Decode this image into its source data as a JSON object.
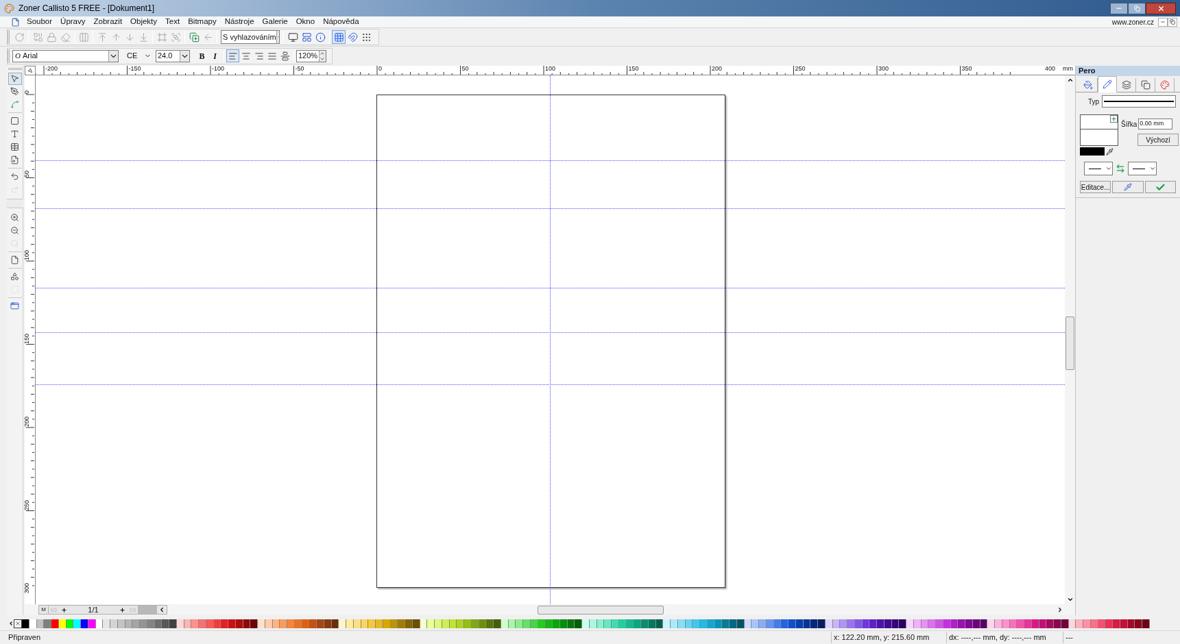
{
  "window": {
    "title": "Zoner Callisto 5 FREE - [Dokument1]"
  },
  "menu": {
    "items": [
      "Soubor",
      "Úpravy",
      "Zobrazit",
      "Objekty",
      "Text",
      "Bitmapy",
      "Nástroje",
      "Galerie",
      "Okno",
      "Nápověda"
    ],
    "link": "www.zoner.cz"
  },
  "toolbar": [
    {
      "kind": "refresh",
      "disabled": true
    },
    {
      "kind": "separator"
    },
    {
      "kind": "combine",
      "disabled": true
    },
    {
      "kind": "lock",
      "disabled": true
    },
    {
      "kind": "eraser",
      "disabled": true
    },
    {
      "kind": "separator"
    },
    {
      "kind": "columns",
      "disabled": true
    },
    {
      "kind": "separator"
    },
    {
      "kind": "to-top",
      "disabled": true
    },
    {
      "kind": "up",
      "disabled": true
    },
    {
      "kind": "down",
      "disabled": true
    },
    {
      "kind": "to-bottom",
      "disabled": true
    },
    {
      "kind": "separator"
    },
    {
      "kind": "frame",
      "disabled": true
    },
    {
      "kind": "group",
      "disabled": true
    },
    {
      "kind": "separator"
    },
    {
      "kind": "add-object",
      "disabled": false
    },
    {
      "kind": "back",
      "disabled": true
    },
    {
      "kind": "separator"
    },
    {
      "kind": "dropdown",
      "value": "S vyhlazováním"
    },
    {
      "kind": "separator"
    },
    {
      "kind": "monitor",
      "disabled": false
    },
    {
      "kind": "layout",
      "disabled": false
    },
    {
      "kind": "info",
      "disabled": false
    },
    {
      "kind": "separator"
    },
    {
      "kind": "grid",
      "disabled": false,
      "pressed": true
    },
    {
      "kind": "snap",
      "disabled": false,
      "pressed": false
    },
    {
      "kind": "dots",
      "disabled": false,
      "pressed": false
    }
  ],
  "format_bar": {
    "font_glyph": "O",
    "font": "Arial",
    "charset": "CE",
    "size": "24.0",
    "style_buttons": [
      {
        "label": "B",
        "pressed": false
      },
      {
        "label": "I",
        "pressed": false
      }
    ],
    "align_buttons": [
      {
        "kind": "left",
        "selected": true
      },
      {
        "kind": "center",
        "selected": false
      },
      {
        "kind": "right",
        "selected": false
      },
      {
        "kind": "justify",
        "selected": false
      },
      {
        "kind": "full",
        "selected": false
      }
    ],
    "zoom": "120%"
  },
  "toolbox": [
    {
      "kind": "pointer",
      "disabled": false,
      "selected": true
    },
    {
      "kind": "shape",
      "disabled": false,
      "selected": false
    },
    {
      "kind": "nodes",
      "disabled": false,
      "selected": false
    },
    {
      "kind": "separator"
    },
    {
      "kind": "rectangle",
      "disabled": false,
      "selected": false
    },
    {
      "kind": "text",
      "disabled": false,
      "selected": false
    },
    {
      "kind": "table",
      "disabled": false,
      "selected": false
    },
    {
      "kind": "import",
      "disabled": false,
      "selected": false
    },
    {
      "kind": "separator"
    },
    {
      "kind": "undo",
      "disabled": false,
      "selected": false
    },
    {
      "kind": "redo",
      "disabled": true,
      "selected": false
    },
    {
      "kind": "break"
    },
    {
      "kind": "zoom-in",
      "disabled": false,
      "selected": false
    },
    {
      "kind": "zoom-out",
      "disabled": false,
      "selected": false
    },
    {
      "kind": "zoom-back",
      "disabled": true,
      "selected": false
    },
    {
      "kind": "separator"
    },
    {
      "kind": "page",
      "disabled": false,
      "selected": false
    },
    {
      "kind": "separator"
    },
    {
      "kind": "shape-tool",
      "disabled": false,
      "selected": false
    },
    {
      "kind": "bounds",
      "disabled": true,
      "selected": false
    },
    {
      "kind": "separator"
    },
    {
      "kind": "window",
      "disabled": false,
      "selected": false
    }
  ],
  "horizontal_ruler": {
    "labels": [
      "-200",
      "-150",
      "-100",
      "-50",
      "0",
      "50",
      "100",
      "150",
      "200",
      "250",
      "300",
      "350",
      "400"
    ],
    "unit": "mm"
  },
  "vertical_ruler": {
    "labels": [
      "0",
      "50",
      "100",
      "150",
      "200",
      "250",
      "300"
    ]
  },
  "page_nav": {
    "first_label": "M",
    "page": "1/1"
  },
  "panel": {
    "title": "Pero",
    "tabs": [
      {
        "kind": "fill",
        "selected": false
      },
      {
        "kind": "pen",
        "selected": true
      },
      {
        "kind": "transparency",
        "selected": false
      },
      {
        "kind": "shadow",
        "selected": false
      },
      {
        "kind": "palette",
        "selected": false
      }
    ],
    "type_label": "Typ",
    "width_label": "Šířka",
    "width_value": "0.00 mm",
    "default_button": "Výchozí",
    "edit_button": "Editace..."
  },
  "palette": [
    {
      "color": "#000000"
    },
    {
      "color": "#ffffff"
    },
    {
      "color": "#c0c0c0"
    },
    {
      "color": "#808080"
    },
    {
      "color": "#ff0000"
    },
    {
      "color": "#ffff00"
    },
    {
      "color": "#00ff00"
    },
    {
      "color": "#00ffff"
    },
    {
      "color": "#0000ff"
    },
    {
      "color": "#ff00ff"
    },
    {
      "color": "#ffffff"
    },
    {
      "color": "#e6e6e6"
    },
    {
      "color": "#d4d4d4"
    },
    {
      "color": "#c4c4c4"
    },
    {
      "color": "#b4b4b4"
    },
    {
      "color": "#a4a4a4"
    },
    {
      "color": "#949494"
    },
    {
      "color": "#848484"
    },
    {
      "color": "#6e6e6e"
    },
    {
      "color": "#585858"
    },
    {
      "color": "#404040"
    },
    {
      "color": "#ffd6d6"
    },
    {
      "color": "#ffb3b3"
    },
    {
      "color": "#ff9090"
    },
    {
      "color": "#f87171"
    },
    {
      "color": "#ff5555"
    },
    {
      "color": "#f03c3c"
    },
    {
      "color": "#e52020"
    },
    {
      "color": "#d01010"
    },
    {
      "color": "#b00c0c"
    },
    {
      "color": "#900808"
    },
    {
      "color": "#700404"
    },
    {
      "color": "#ffe0cc"
    },
    {
      "color": "#ffcba8"
    },
    {
      "color": "#ffb380"
    },
    {
      "color": "#f99b5a"
    },
    {
      "color": "#f5853a"
    },
    {
      "color": "#ee7020"
    },
    {
      "color": "#e06010"
    },
    {
      "color": "#c85010"
    },
    {
      "color": "#a84510"
    },
    {
      "color": "#883a10"
    },
    {
      "color": "#6c2e08"
    },
    {
      "color": "#fff5cc"
    },
    {
      "color": "#ffeaa0"
    },
    {
      "color": "#fde080"
    },
    {
      "color": "#f9d560"
    },
    {
      "color": "#f3c840"
    },
    {
      "color": "#e8b820"
    },
    {
      "color": "#d8a800"
    },
    {
      "color": "#bf9400"
    },
    {
      "color": "#a07c00"
    },
    {
      "color": "#846400"
    },
    {
      "color": "#6a5000"
    },
    {
      "color": "#f4ffcc"
    },
    {
      "color": "#eaff99"
    },
    {
      "color": "#ddf77a"
    },
    {
      "color": "#cfee55"
    },
    {
      "color": "#c0e430"
    },
    {
      "color": "#acd420"
    },
    {
      "color": "#95c010"
    },
    {
      "color": "#80a810"
    },
    {
      "color": "#6c900c"
    },
    {
      "color": "#587608"
    },
    {
      "color": "#465e04"
    },
    {
      "color": "#ccffcc"
    },
    {
      "color": "#a8f5a8"
    },
    {
      "color": "#88ee88"
    },
    {
      "color": "#66e066"
    },
    {
      "color": "#44d644"
    },
    {
      "color": "#22cc22"
    },
    {
      "color": "#10bb10"
    },
    {
      "color": "#08a808"
    },
    {
      "color": "#04900a"
    },
    {
      "color": "#027808"
    },
    {
      "color": "#016006"
    },
    {
      "color": "#ccfff0"
    },
    {
      "color": "#a8f7e0"
    },
    {
      "color": "#88f0d0"
    },
    {
      "color": "#66e8c0"
    },
    {
      "color": "#40dcb0"
    },
    {
      "color": "#20d0a0"
    },
    {
      "color": "#10bc90"
    },
    {
      "color": "#08a880"
    },
    {
      "color": "#049070"
    },
    {
      "color": "#027860"
    },
    {
      "color": "#016050"
    },
    {
      "color": "#ccf4ff"
    },
    {
      "color": "#a8eafa"
    },
    {
      "color": "#88e0f5"
    },
    {
      "color": "#66d4f0"
    },
    {
      "color": "#40c8ec"
    },
    {
      "color": "#20bce4"
    },
    {
      "color": "#10a8d0"
    },
    {
      "color": "#0894b8"
    },
    {
      "color": "#047c9c"
    },
    {
      "color": "#026882"
    },
    {
      "color": "#015468"
    },
    {
      "color": "#ccdcff"
    },
    {
      "color": "#a8c4fa"
    },
    {
      "color": "#88acf5"
    },
    {
      "color": "#6694f0"
    },
    {
      "color": "#447ceb"
    },
    {
      "color": "#2264e4"
    },
    {
      "color": "#1050d0"
    },
    {
      "color": "#0840b4"
    },
    {
      "color": "#04349a"
    },
    {
      "color": "#022880"
    },
    {
      "color": "#011e66"
    },
    {
      "color": "#e0d4ff"
    },
    {
      "color": "#c8b4fa"
    },
    {
      "color": "#b094f5"
    },
    {
      "color": "#9874f0"
    },
    {
      "color": "#8454e8"
    },
    {
      "color": "#7034e0"
    },
    {
      "color": "#6020cc"
    },
    {
      "color": "#5010b0"
    },
    {
      "color": "#420896"
    },
    {
      "color": "#34047c"
    },
    {
      "color": "#280264"
    },
    {
      "color": "#f8d4ff"
    },
    {
      "color": "#f0b0fa"
    },
    {
      "color": "#e890f5"
    },
    {
      "color": "#de70f0"
    },
    {
      "color": "#d250ea"
    },
    {
      "color": "#c430e0"
    },
    {
      "color": "#b020cc"
    },
    {
      "color": "#9a10b0"
    },
    {
      "color": "#840896"
    },
    {
      "color": "#6e047c"
    },
    {
      "color": "#580264"
    },
    {
      "color": "#ffd4ec"
    },
    {
      "color": "#ffb0dc"
    },
    {
      "color": "#ff90cc"
    },
    {
      "color": "#fa70bc"
    },
    {
      "color": "#f550ac"
    },
    {
      "color": "#ee309a"
    },
    {
      "color": "#dc1888"
    },
    {
      "color": "#c41074"
    },
    {
      "color": "#a80860"
    },
    {
      "color": "#8c044e"
    },
    {
      "color": "#70023e"
    },
    {
      "color": "#ffd4dc"
    },
    {
      "color": "#ffb0c0"
    },
    {
      "color": "#ff90a4"
    },
    {
      "color": "#fa7088"
    },
    {
      "color": "#f5506e"
    },
    {
      "color": "#ee3056"
    },
    {
      "color": "#dc1844"
    },
    {
      "color": "#c41036"
    },
    {
      "color": "#a80828"
    },
    {
      "color": "#8c041e"
    },
    {
      "color": "#700214"
    }
  ],
  "status_bar": [
    "Připraven",
    "x: 122.20 mm, y: 215.60 mm",
    "dx: ----,--- mm, dy: ----,--- mm",
    "---"
  ]
}
